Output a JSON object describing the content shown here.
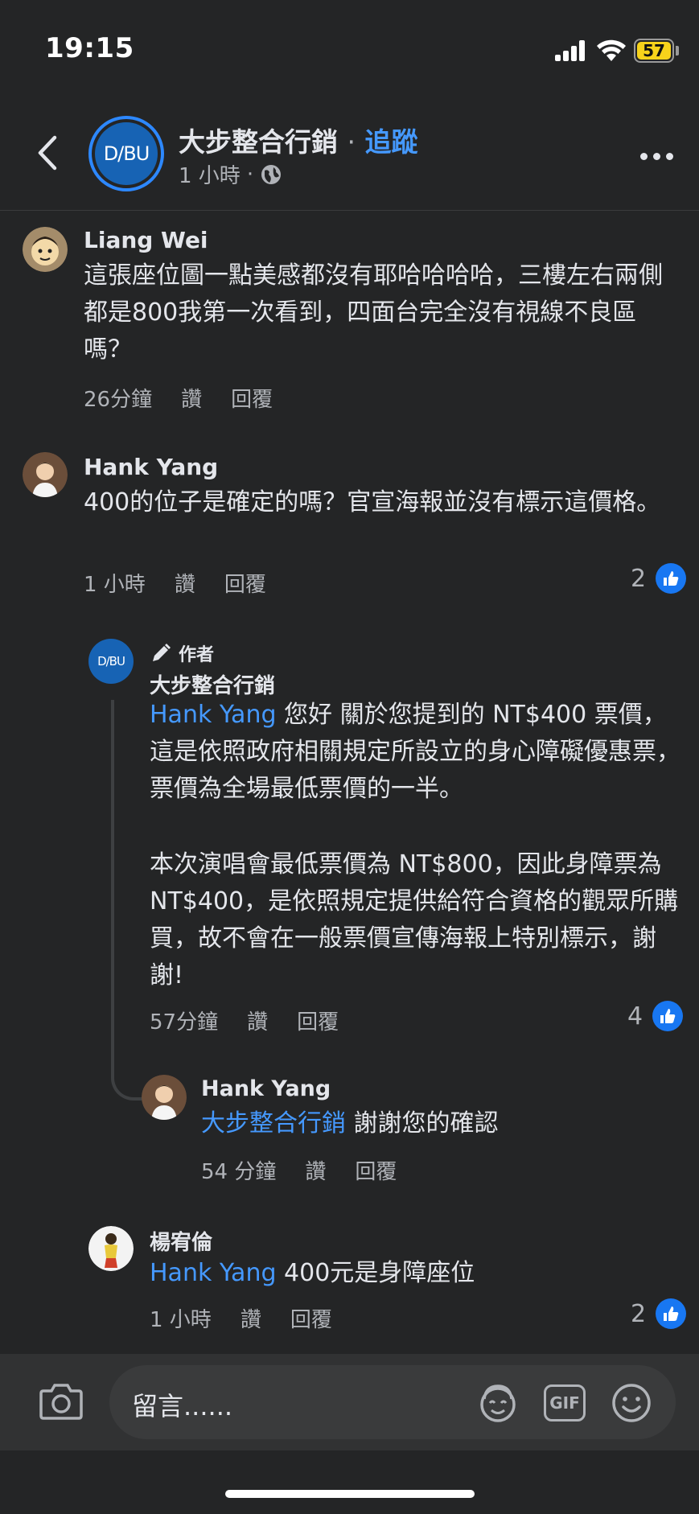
{
  "status_bar": {
    "time": "19:15",
    "battery": "57"
  },
  "header": {
    "page_name": "大步整合行銷",
    "separator": "·",
    "follow": "追蹤",
    "post_time": "1 小時",
    "meta_sep": "·",
    "avatar_text": "D/BU"
  },
  "comments": [
    {
      "name": "Liang Wei",
      "text": "這張座位圖一點美感都沒有耶哈哈哈哈，三樓左右兩側都是800我第一次看到，四面台完全沒有視線不良區嗎？",
      "time": "26分鐘",
      "like": "讚",
      "reply": "回覆"
    },
    {
      "name": "Hank Yang",
      "text": "400的位子是確定的嗎？官宣海報並沒有標示這價格。",
      "time": "1 小時",
      "like": "讚",
      "reply": "回覆",
      "like_count": "2"
    }
  ],
  "replies": [
    {
      "author_badge": "作者",
      "name": "大步整合行銷",
      "avatar_text": "D/BU",
      "mention": "Hank Yang",
      "text_1": " 您好 關於您提到的 NT$400 票價，這是依照政府相關規定所設立的身心障礙優惠票，票價為全場最低票價的一半。",
      "text_2": "本次演唱會最低票價為 NT$800，因此身障票為 NT$400，是依照規定提供給符合資格的觀眾所購買，故不會在一般票價宣傳海報上特別標示，謝謝!",
      "time": "57分鐘",
      "like": "讚",
      "reply": "回覆",
      "like_count": "4"
    },
    {
      "name": "Hank Yang",
      "mention": "大步整合行銷",
      "text": " 謝謝您的確認",
      "time": "54 分鐘",
      "like": "讚",
      "reply": "回覆"
    },
    {
      "name": "楊宥倫",
      "mention": "Hank Yang",
      "text": " 400元是身障座位",
      "time": "1 小時",
      "like": "讚",
      "reply": "回覆",
      "like_count": "2"
    }
  ],
  "composer": {
    "placeholder": "留言......",
    "gif_label": "GIF"
  }
}
